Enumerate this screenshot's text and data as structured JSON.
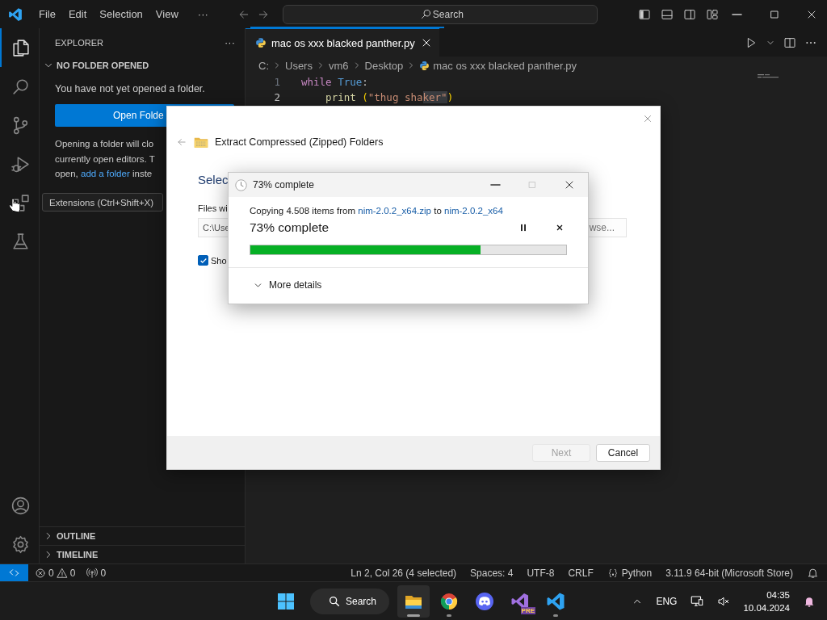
{
  "titlebar": {
    "menu": [
      "File",
      "Edit",
      "Selection",
      "View"
    ],
    "more": "···",
    "search": {
      "placeholder": "Search"
    }
  },
  "activity_bar": {
    "items": [
      {
        "kind": "explorer",
        "selected": true
      },
      {
        "kind": "search",
        "selected": false
      },
      {
        "kind": "source-control",
        "selected": false
      },
      {
        "kind": "run",
        "selected": false
      },
      {
        "kind": "extensions",
        "selected": false
      },
      {
        "kind": "testing",
        "selected": false
      }
    ],
    "bottom": [
      {
        "kind": "accounts"
      },
      {
        "kind": "settings"
      }
    ]
  },
  "tooltip": {
    "text": "Extensions (Ctrl+Shift+X)"
  },
  "sidebar": {
    "title": "EXPLORER",
    "more": "···",
    "section": {
      "title": "NO FOLDER OPENED",
      "expanded": true,
      "message": "You have not yet opened a folder.",
      "button": "Open Folde",
      "paragraph": [
        {
          "text": "Opening a folder will clo\ncurrently open editors. T\nopen, ",
          "kind": "plain"
        },
        {
          "text": "add a folder",
          "kind": "link"
        },
        {
          "text": " inste",
          "kind": "plain"
        }
      ]
    },
    "panels": [
      {
        "title": "OUTLINE",
        "expanded": false
      },
      {
        "title": "TIMELINE",
        "expanded": false
      }
    ]
  },
  "editor": {
    "tabs": [
      {
        "label": "mac os xxx blacked panther.py",
        "selected": true
      }
    ],
    "breadcrumbs": [
      "C:",
      "Users",
      "vm6",
      "Desktop",
      "mac os xxx blacked panther.py"
    ],
    "lines": [
      {
        "number": "1",
        "current": false,
        "tokens": [
          {
            "text": "while ",
            "kind": "keyword",
            "selected": false
          },
          {
            "text": "True",
            "kind": "constant",
            "selected": false
          },
          {
            "text": ":",
            "kind": "plain",
            "selected": false
          }
        ]
      },
      {
        "number": "2",
        "current": true,
        "tokens": [
          {
            "text": "    print ",
            "kind": "function",
            "selected": false
          },
          {
            "text": "(",
            "kind": "bracket",
            "selected": false
          },
          {
            "text": "\"thug sha",
            "kind": "string",
            "selected": false
          },
          {
            "text": "ker\"",
            "kind": "string",
            "selected": true
          },
          {
            "text": ")",
            "kind": "bracket",
            "selected": false
          }
        ]
      }
    ]
  },
  "extract_dialog": {
    "title": "Extract Compressed (Zipped) Folders",
    "heading": "Selec",
    "field_label": "Files wi",
    "path_value": "C:\\Use",
    "browse": "wse...",
    "checkbox": {
      "label": "Sho",
      "checked": true
    },
    "buttons": [
      {
        "label": "Next",
        "disabled": true
      },
      {
        "label": "Cancel",
        "disabled": false
      }
    ]
  },
  "progress_dialog": {
    "title": "73% complete",
    "maximize_disabled": true,
    "message": [
      {
        "text": "Copying 4.508 items from ",
        "kind": "plain"
      },
      {
        "text": "nim-2.0.2_x64.zip",
        "kind": "link"
      },
      {
        "text": " to ",
        "kind": "plain"
      },
      {
        "text": "nim-2.0.2_x64",
        "kind": "link"
      }
    ],
    "status": "73% complete",
    "level": 0.73,
    "details": {
      "label": "More details",
      "expanded": false
    }
  },
  "status_bar": {
    "errors": "0",
    "warnings": "0",
    "ports": "0",
    "items": [
      {
        "text": "Ln 2, Col 26 (4 selected)",
        "kind": "text"
      },
      {
        "text": "Spaces: 4",
        "kind": "text"
      },
      {
        "text": "UTF-8",
        "kind": "text"
      },
      {
        "text": "CRLF",
        "kind": "text"
      },
      {
        "text": "Python",
        "kind": "language"
      },
      {
        "text": "3.11.9 64-bit (Microsoft Store)",
        "kind": "text"
      }
    ]
  },
  "taskbar": {
    "search": "Search",
    "apps": [
      {
        "kind": "file-explorer",
        "running": true,
        "active": true
      },
      {
        "kind": "chrome",
        "running": true,
        "active": false
      },
      {
        "kind": "discord",
        "running": false,
        "active": false
      },
      {
        "kind": "visual-studio",
        "running": false,
        "active": false,
        "badge": "PRE"
      },
      {
        "kind": "vscode",
        "running": true,
        "active": false
      }
    ],
    "language": "ENG",
    "time": "04:35",
    "date": "10.04.2024"
  }
}
